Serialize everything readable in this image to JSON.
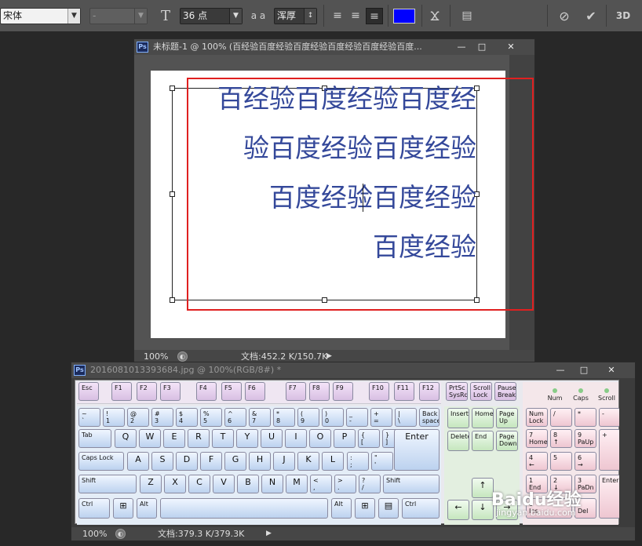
{
  "options_bar": {
    "font_family": "宋体",
    "font_style": "-",
    "size_icon": "font-size-icon",
    "font_size": "36 点",
    "aa_label": "a a",
    "antialias": "浑厚",
    "text_color": "#0000ff"
  },
  "doc1": {
    "title": "未标题-1 @ 100% (百经验百度经验百度经验百度经验百度经验百度...",
    "lines": [
      "百经验百度经验百度经",
      "验百度经验百度经验",
      "百度经验百度经验",
      "百度经验"
    ],
    "zoom": "100%",
    "docinfo": "文档:452.2 K/150.7K",
    "highlight_color": "#e02020"
  },
  "doc2": {
    "title": "2016081013393684.jpg @ 100%(RGB/8#) *",
    "zoom": "100%",
    "docinfo": "文档:379.3 K/379.3K",
    "fkeys": [
      "Esc",
      "F1",
      "F2",
      "F3",
      "F4",
      "F5",
      "F6",
      "F7",
      "F8",
      "F9",
      "F10",
      "F11",
      "F12"
    ],
    "sys_keys": [
      [
        "PrtSc",
        "SysRq"
      ],
      [
        "Scroll",
        "Lock"
      ],
      [
        "Pause",
        "Break"
      ]
    ],
    "leds": [
      "Num",
      "Caps",
      "Scroll"
    ],
    "row1": [
      [
        "~",
        "`"
      ],
      [
        "!",
        "1"
      ],
      [
        "@",
        "2"
      ],
      [
        "#",
        "3"
      ],
      [
        "$",
        "4"
      ],
      [
        "%",
        "5"
      ],
      [
        "^",
        "6"
      ],
      [
        "&",
        "7"
      ],
      [
        "*",
        "8"
      ],
      [
        "(",
        "9"
      ],
      [
        ")",
        "0"
      ],
      [
        "_",
        "-"
      ],
      [
        "+",
        "="
      ],
      [
        "|",
        "\\"
      ]
    ],
    "backspace": "Back space",
    "row2": [
      "Tab",
      "Q",
      "W",
      "E",
      "R",
      "T",
      "Y",
      "U",
      "I",
      "O",
      "P"
    ],
    "row2b": [
      [
        "{",
        "["
      ],
      [
        "}",
        "]"
      ]
    ],
    "row3": [
      "Caps Lock",
      "A",
      "S",
      "D",
      "F",
      "G",
      "H",
      "J",
      "K",
      "L"
    ],
    "row3b": [
      [
        ":",
        ";"
      ],
      [
        "\"",
        "'"
      ]
    ],
    "enter": "Enter",
    "row4": [
      "Shift",
      "Z",
      "X",
      "C",
      "V",
      "B",
      "N",
      "M"
    ],
    "row4b": [
      [
        "<",
        ","
      ],
      [
        ">",
        "."
      ],
      [
        "?",
        "/"
      ]
    ],
    "shift_r": "Shift",
    "row5": [
      "Ctrl",
      "Alt",
      "Alt",
      "Ctrl"
    ],
    "nav": [
      "Insert",
      "Home",
      "Page Up",
      "Delete",
      "End",
      "Page Down"
    ],
    "num": [
      [
        "Num",
        "Lock"
      ],
      [
        "/",
        ""
      ],
      [
        "*",
        ""
      ],
      [
        "-",
        ""
      ],
      [
        "7",
        "Home"
      ],
      [
        "8",
        "↑"
      ],
      [
        "9",
        "PaUp"
      ],
      [
        "+",
        ""
      ],
      [
        "4",
        "←"
      ],
      [
        "5",
        ""
      ],
      [
        "6",
        "→"
      ],
      [
        "1",
        "End"
      ],
      [
        "2",
        "↓"
      ],
      [
        "3",
        "PaDn"
      ],
      [
        "0",
        "Ins"
      ],
      [
        ".",
        "Del"
      ],
      [
        "Enter",
        ""
      ]
    ],
    "watermark": "Baidu经验",
    "watermark_url": "jingyan.baidu.com"
  }
}
